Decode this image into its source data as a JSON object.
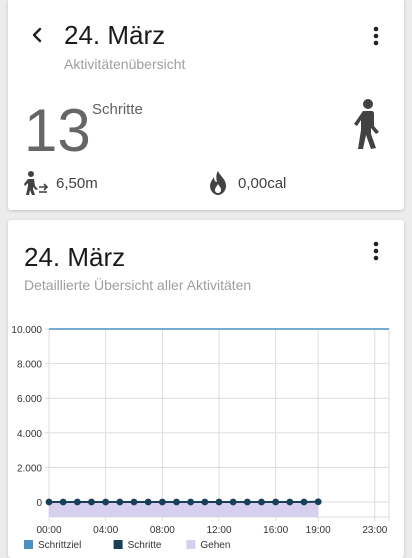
{
  "summary_card": {
    "title": "24. März",
    "subtitle": "Aktivitätenübersicht",
    "steps_value": "13",
    "steps_label": "Schritte",
    "distance": "6,50m",
    "calories": "0,00cal",
    "icons": [
      "back-arrow-icon",
      "more-vert-icon",
      "walking-person-icon",
      "distance-walk-icon",
      "flame-icon"
    ]
  },
  "detail_card": {
    "title": "24. März",
    "subtitle": "Detaillierte Übersicht aller Aktivitäten",
    "icons": [
      "more-vert-icon"
    ]
  },
  "colors": {
    "goal_line": "#4a90c2",
    "steps_line": "#173f5a",
    "walking_fill": "#d6cfee",
    "grid": "#dddddd"
  },
  "chart_data": {
    "type": "line",
    "x_labels": [
      "00:00",
      "04:00",
      "08:00",
      "12:00",
      "16:00",
      "19:00",
      "23:00"
    ],
    "x_label_hours": [
      0,
      4,
      8,
      12,
      16,
      19,
      23
    ],
    "xlim": [
      0,
      24
    ],
    "y_labels": [
      "10.000",
      "8.000",
      "6.000",
      "4.000",
      "2.000",
      "0"
    ],
    "y_label_values": [
      10000,
      8000,
      6000,
      4000,
      2000,
      0
    ],
    "ylim": [
      0,
      10000
    ],
    "grid": true,
    "legend_position": "bottom-left",
    "series": [
      {
        "name": "Schrittziel",
        "type": "line",
        "color": "#4a90c2",
        "x": [
          0,
          24
        ],
        "values": [
          10000,
          10000
        ]
      },
      {
        "name": "Schritte",
        "type": "line-with-points",
        "color": "#173f5a",
        "x": [
          0,
          1,
          2,
          3,
          4,
          5,
          6,
          7,
          8,
          9,
          10,
          11,
          12,
          13,
          14,
          15,
          16,
          17,
          18,
          19
        ],
        "values": [
          0,
          0,
          0,
          0,
          0,
          0,
          0,
          0,
          0,
          0,
          0,
          0,
          0,
          0,
          0,
          0,
          0,
          0,
          0,
          13
        ]
      },
      {
        "name": "Gehen",
        "type": "area",
        "color": "#d6cfee",
        "x": [
          0,
          19
        ],
        "values": [
          0,
          0
        ]
      }
    ]
  }
}
